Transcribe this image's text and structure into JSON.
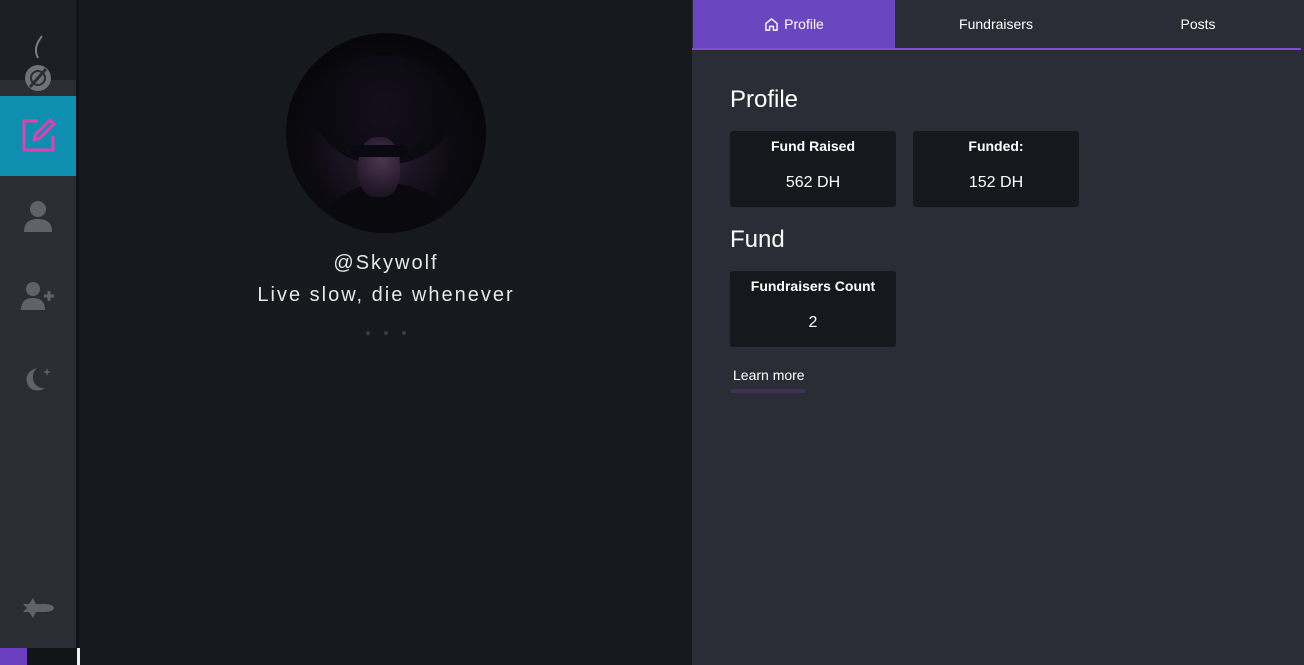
{
  "sidebar": {
    "items": [
      {
        "name": "edit",
        "icon": "edit-icon",
        "active": true
      },
      {
        "name": "profile",
        "icon": "user-icon"
      },
      {
        "name": "add-user",
        "icon": "add-user-icon"
      },
      {
        "name": "theme",
        "icon": "moon-stars-icon"
      },
      {
        "name": "logout",
        "icon": "rocket-icon"
      }
    ],
    "colors": {
      "active": "#0e8fb0",
      "icon": "#6b6e74",
      "edit_icon": "#e040b0"
    }
  },
  "profile": {
    "username": "@Skywolf",
    "bio": "Live slow, die whenever"
  },
  "tabs": [
    {
      "label": "Profile",
      "icon": "home-icon",
      "active": true
    },
    {
      "label": "Fundraisers"
    },
    {
      "label": "Posts"
    }
  ],
  "main": {
    "profile_section": {
      "title": "Profile",
      "cards": [
        {
          "label": "Fund Raised",
          "value": "562 DH"
        },
        {
          "label": "Funded:",
          "value": "152 DH"
        }
      ]
    },
    "fund_section": {
      "title": "Fund",
      "cards": [
        {
          "label": "Fundraisers Count",
          "value": "2"
        }
      ]
    },
    "learn_more": "Learn more"
  },
  "colors": {
    "accent": "#6b46c1",
    "background": "#16191d",
    "panel": "#2a2d35",
    "card": "#15181c"
  }
}
